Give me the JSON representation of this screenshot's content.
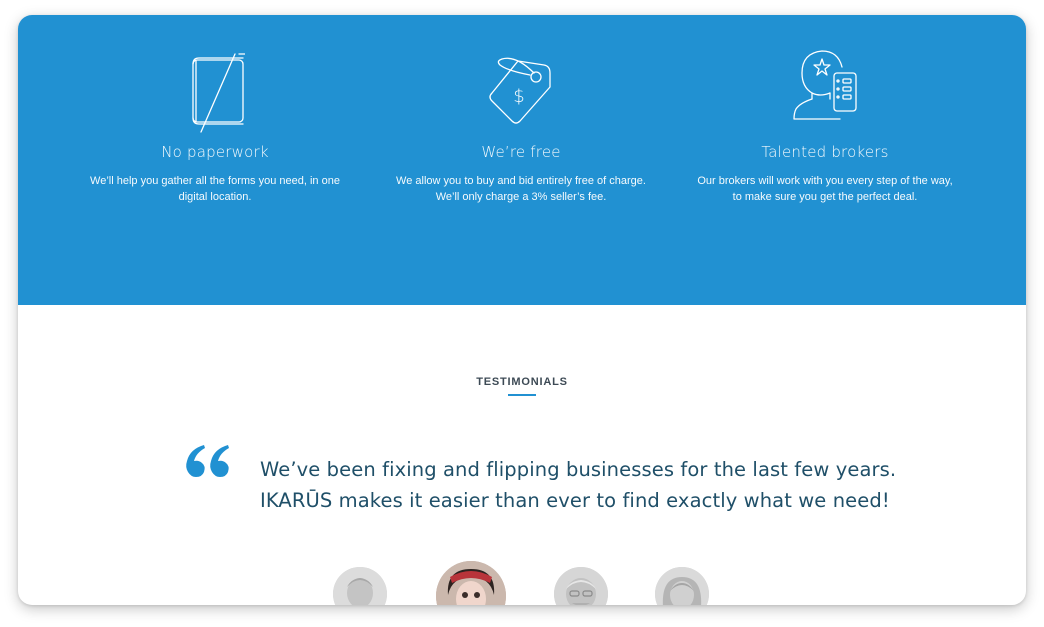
{
  "features": [
    {
      "icon": "book-icon",
      "title": "No paperwork",
      "description": "We’ll help you gather all the forms you need, in one digital location."
    },
    {
      "icon": "price-tag-icon",
      "title": "We’re free",
      "description": "We allow you to buy and bid entirely free of charge.  We’ll only charge a 3% seller’s fee."
    },
    {
      "icon": "broker-icon",
      "title": "Talented brokers",
      "description": "Our brokers will work with you every step of the way, to make sure you get the perfect deal."
    }
  ],
  "testimonials": {
    "heading": "TESTIMONIALS",
    "quote_line1": "We’ve been fixing and flipping businesses for the last few years.",
    "quote_line2": "IKARŪS makes it easier than ever to find exactly what we need!",
    "avatars": [
      "avatar-1",
      "avatar-2-active",
      "avatar-3",
      "avatar-4"
    ]
  },
  "colors": {
    "brand_blue": "#2191d2",
    "quote_text": "#1f4f68",
    "heading_text": "#3d4a55"
  }
}
